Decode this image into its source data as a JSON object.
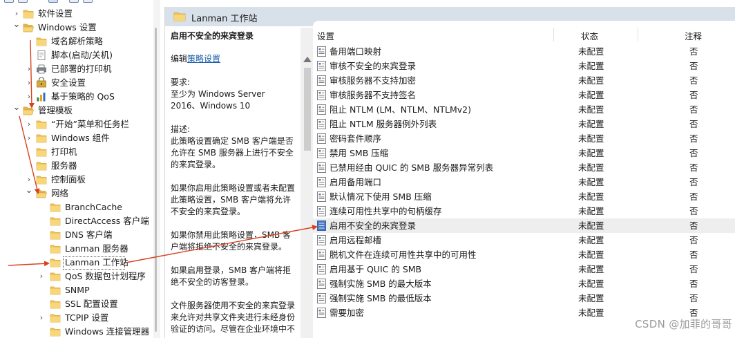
{
  "tree": {
    "items": [
      {
        "label": "软件设置",
        "chevron": "›",
        "icon": "folder",
        "name": "tree-item-software-settings",
        "level": 1
      },
      {
        "label": "Windows 设置",
        "chevron": "⌄",
        "icon": "folder-open",
        "name": "tree-item-windows-settings",
        "level": 1
      },
      {
        "label": "域名解析策略",
        "chevron": "",
        "icon": "folder",
        "name": "tree-item-name-resolution-policy",
        "level": 2
      },
      {
        "label": "脚本(启动/关机)",
        "chevron": "",
        "icon": "script",
        "name": "tree-item-scripts",
        "level": 2
      },
      {
        "label": "已部署的打印机",
        "chevron": "›",
        "icon": "printer",
        "name": "tree-item-deployed-printers",
        "level": 2
      },
      {
        "label": "安全设置",
        "chevron": "›",
        "icon": "security",
        "name": "tree-item-security-settings",
        "level": 2
      },
      {
        "label": "基于策略的 QoS",
        "chevron": "›",
        "icon": "chart",
        "name": "tree-item-policy-qos",
        "level": 2
      },
      {
        "label": "管理模板",
        "chevron": "⌄",
        "icon": "folder-open",
        "name": "tree-item-admin-templates",
        "level": 1
      },
      {
        "label": "“开始”菜单和任务栏",
        "chevron": "›",
        "icon": "folder",
        "name": "tree-item-start-menu",
        "level": 2
      },
      {
        "label": "Windows 组件",
        "chevron": "›",
        "icon": "folder",
        "name": "tree-item-windows-components",
        "level": 2
      },
      {
        "label": "打印机",
        "chevron": "",
        "icon": "folder",
        "name": "tree-item-printers",
        "level": 2
      },
      {
        "label": "服务器",
        "chevron": "",
        "icon": "folder",
        "name": "tree-item-server",
        "level": 2
      },
      {
        "label": "控制面板",
        "chevron": "›",
        "icon": "folder",
        "name": "tree-item-control-panel",
        "level": 2
      },
      {
        "label": "网络",
        "chevron": "⌄",
        "icon": "folder-open",
        "name": "tree-item-network",
        "level": 2
      },
      {
        "label": "BranchCache",
        "chevron": "",
        "icon": "folder",
        "name": "tree-item-branchcache",
        "level": 3
      },
      {
        "label": "DirectAccess 客户端",
        "chevron": "",
        "icon": "folder",
        "name": "tree-item-directaccess",
        "level": 3
      },
      {
        "label": "DNS 客户端",
        "chevron": "",
        "icon": "folder",
        "name": "tree-item-dns-client",
        "level": 3
      },
      {
        "label": "Lanman 服务器",
        "chevron": "",
        "icon": "folder",
        "name": "tree-item-lanman-server",
        "level": 3
      },
      {
        "label": "Lanman 工作站",
        "chevron": "",
        "icon": "folder",
        "name": "tree-item-lanman-workstation",
        "level": 3,
        "selected": true
      },
      {
        "label": "QoS 数据包计划程序",
        "chevron": "›",
        "icon": "folder",
        "name": "tree-item-qos-packet-scheduler",
        "level": 3
      },
      {
        "label": "SNMP",
        "chevron": "",
        "icon": "folder",
        "name": "tree-item-snmp",
        "level": 3
      },
      {
        "label": "SSL 配置设置",
        "chevron": "",
        "icon": "folder",
        "name": "tree-item-ssl-config",
        "level": 3
      },
      {
        "label": "TCPIP 设置",
        "chevron": "›",
        "icon": "folder",
        "name": "tree-item-tcpip",
        "level": 3
      },
      {
        "label": "Windows 连接管理器",
        "chevron": "",
        "icon": "folder",
        "name": "tree-item-windows-connection-manager",
        "level": 3
      }
    ]
  },
  "header": {
    "title": "Lanman 工作站"
  },
  "description": {
    "title": "启用不安全的来宾登录",
    "edit_prefix": "编辑",
    "edit_link": "策略设置",
    "req_label": "要求:",
    "req_text": "至少为 Windows Server 2016、Windows 10",
    "desc_label": "描述:",
    "p1": "此策略设置确定 SMB 客户端是否允许在 SMB 服务器上进行不安全的来宾登录。",
    "p2": "如果你启用此策略设置或者未配置此策略设置，SMB 客户端将允许不安全的来宾登录。",
    "p3": "如果你禁用此策略设置，SMB 客户端将拒绝不安全的来宾登录。",
    "p4": "如果启用登录，SMB 客户端将拒绝不安全的访客登录。",
    "p5": "文件服务器使用不安全的来宾登录来允许对共享文件夹进行未经身份验证的访问。尽管在企业环境中不"
  },
  "list": {
    "headers": {
      "setting": "设置",
      "state": "状态",
      "note": "注释"
    },
    "rows": [
      {
        "name": "备用端口映射",
        "state": "未配置",
        "note": "否"
      },
      {
        "name": "审核不安全的来宾登录",
        "state": "未配置",
        "note": "否"
      },
      {
        "name": "审核服务器不支持加密",
        "state": "未配置",
        "note": "否"
      },
      {
        "name": "审核服务器不支持签名",
        "state": "未配置",
        "note": "否"
      },
      {
        "name": "阻止 NTLM (LM、NTLM、NTLMv2)",
        "state": "未配置",
        "note": "否"
      },
      {
        "name": "阻止 NTLM 服务器例外列表",
        "state": "未配置",
        "note": "否"
      },
      {
        "name": "密码套件顺序",
        "state": "未配置",
        "note": "否"
      },
      {
        "name": "禁用 SMB 压缩",
        "state": "未配置",
        "note": "否"
      },
      {
        "name": "已禁用经由 QUIC 的 SMB 服务器异常列表",
        "state": "未配置",
        "note": "否"
      },
      {
        "name": "启用备用端口",
        "state": "未配置",
        "note": "否"
      },
      {
        "name": "默认情况下使用 SMB 压缩",
        "state": "未配置",
        "note": "否"
      },
      {
        "name": "连续可用性共享中的句柄缓存",
        "state": "未配置",
        "note": "否"
      },
      {
        "name": "启用不安全的来宾登录",
        "state": "未配置",
        "note": "否",
        "highlight": true
      },
      {
        "name": "启用远程邮槽",
        "state": "未配置",
        "note": "否"
      },
      {
        "name": "脱机文件在连续可用性共享中的可用性",
        "state": "未配置",
        "note": "否"
      },
      {
        "name": "启用基于 QUIC 的 SMB",
        "state": "未配置",
        "note": "否"
      },
      {
        "name": "强制实施 SMB 的最大版本",
        "state": "未配置",
        "note": "否"
      },
      {
        "name": "强制实施 SMB 的最低版本",
        "state": "未配置",
        "note": "否"
      },
      {
        "name": "需要加密",
        "state": "未配置",
        "note": "否"
      }
    ]
  },
  "watermark": "CSDN @加菲的哥哥",
  "colors": {
    "annotation_arrow": "#d9401f",
    "header_bg": "#d8e0ea",
    "link": "#1a5ea8",
    "row_highlight": "#eeeeee"
  }
}
